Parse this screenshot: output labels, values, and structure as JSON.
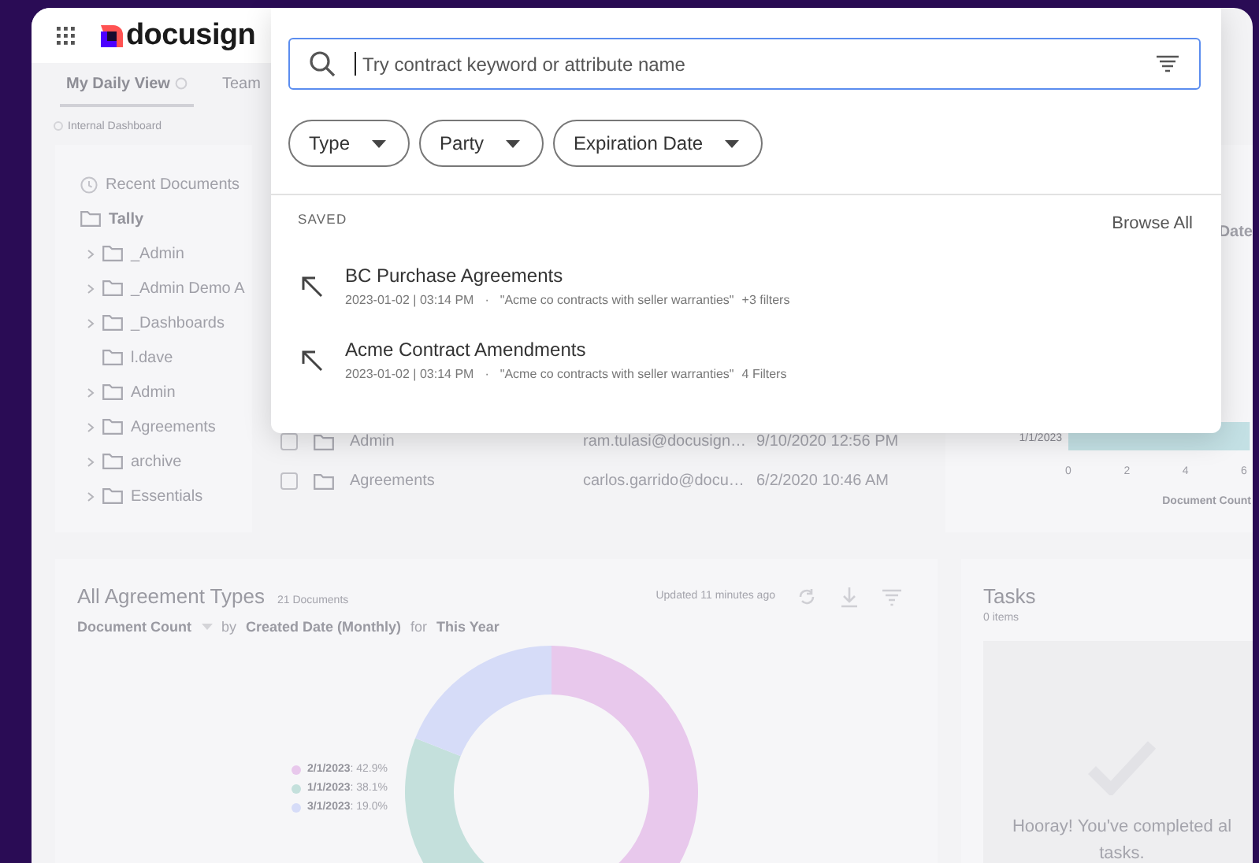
{
  "header": {
    "logo_text": "docusign"
  },
  "tabs": [
    {
      "label": "My Daily View",
      "selected": true
    },
    {
      "label": "Team",
      "selected": false
    }
  ],
  "dashboard_label": "Internal Dashboard",
  "folder_tree": {
    "recent": "Recent Documents",
    "root": {
      "label": "Tally",
      "children": [
        {
          "label": "_Admin",
          "expandable": true
        },
        {
          "label": "_Admin Demo A",
          "expandable": true
        },
        {
          "label": "_Dashboards",
          "expandable": true
        },
        {
          "label": "l.dave",
          "expandable": false
        },
        {
          "label": "Admin",
          "expandable": true
        },
        {
          "label": "Agreements",
          "expandable": true
        },
        {
          "label": "archive",
          "expandable": true
        },
        {
          "label": "Essentials",
          "expandable": true
        }
      ]
    }
  },
  "table": {
    "rows": [
      {
        "name": "Admin",
        "owner": "ram.tulasi@docusign…",
        "modified": "9/10/2020 12:56 PM",
        "checked": false
      },
      {
        "name": "Agreements",
        "owner": "carlos.garrido@docu…",
        "modified": "6/2/2020 10:46 AM",
        "checked": false
      }
    ]
  },
  "bar_panel": {
    "header_fragment": "Date",
    "chart_data": {
      "type": "bar",
      "orientation": "horizontal",
      "xlabel": "Document Count",
      "categories": [
        "1/1/2023"
      ],
      "values": [
        6.2
      ],
      "xlim": [
        0,
        6.3
      ],
      "xticks": [
        0,
        2,
        4,
        6
      ]
    }
  },
  "agreements_card": {
    "title": "All Agreement Types",
    "count": "21 Documents",
    "updated": "Updated 11 minutes ago",
    "measure": "Document Count",
    "by": "by",
    "dimension": "Created Date (Monthly)",
    "for": "for",
    "period": "This Year",
    "legend": [
      {
        "share": ": 42.9%",
        "color": "#e8c8ec"
      },
      {
        "share": ": 38.1%",
        "color": "#c4e0dc"
      },
      {
        "share": ": 19.0%",
        "color": "#d6dcf8"
      }
    ],
    "chart_data": {
      "type": "donut",
      "categories": [
        "2/1/2023",
        "1/1/2023",
        "3/1/2023"
      ],
      "values": [
        42.9,
        38.1,
        19.0
      ]
    }
  },
  "tasks_card": {
    "title": "Tasks",
    "count": "0 items",
    "message_lines": [
      "Hooray! You've completed al",
      "tasks."
    ]
  },
  "search_overlay": {
    "search": {
      "placeholder": "Try contract keyword or attribute name"
    },
    "filters": [
      {
        "label": "Type"
      },
      {
        "label": "Party"
      },
      {
        "label": "Expiration Date"
      }
    ],
    "saved_heading": "SAVED",
    "browse_all": "Browse All",
    "saved_searches": [
      {
        "title": "BC Purchase Agreements",
        "date": "2023-01-02 | 03:14 PM",
        "separator": "·",
        "query": "\"Acme co contracts with seller warranties\"",
        "filters": "+3 filters"
      },
      {
        "title": "Acme Contract Amendments",
        "date": "2023-01-02 | 03:14 PM",
        "separator": "·",
        "query": "\"Acme co contracts with seller warranties\"",
        "filters": "4 Filters"
      }
    ]
  }
}
